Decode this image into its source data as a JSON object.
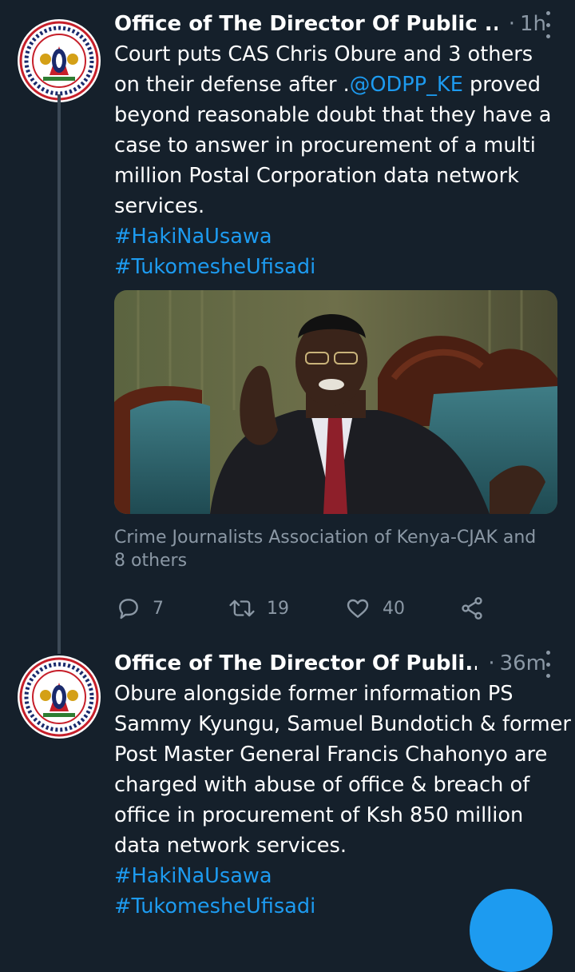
{
  "tweets": [
    {
      "author": "Office of The Director Of Public ...",
      "separator": "·",
      "time": "1h",
      "text_lines": [
        "Court puts CAS Chris Obure and 3 others",
        "on their defense after .",
        "beyond reasonable doubt that they have a",
        "case to answer in procurement of a multi",
        "million Postal Corporation data network",
        "services."
      ],
      "mention": "@ODPP_KE",
      "mention_after": " proved",
      "hashtags": [
        "#HakiNaUsawa",
        "#TukomesheUfisadi"
      ],
      "tagged": [
        "Crime Journalists Association of Kenya-CJAK and",
        "8 others"
      ],
      "actions": {
        "reply": {
          "icon": "reply-icon",
          "count": "7"
        },
        "retweet": {
          "icon": "retweet-icon",
          "count": "19"
        },
        "like": {
          "icon": "heart-icon",
          "count": "40"
        },
        "share": {
          "icon": "share-icon"
        }
      }
    },
    {
      "author": "Office of The Director Of Publi...",
      "separator": "·",
      "time": "36m",
      "text_lines": [
        "Obure alongside former information PS",
        "Sammy Kyungu, Samuel Bundotich & former",
        "Post Master General Francis Chahonyo are",
        "charged with abuse of office & breach of",
        "office in procurement of Ksh 850 million",
        "data network services."
      ],
      "hashtags": [
        "#HakiNaUsawa",
        "#TukomesheUfisadi"
      ]
    }
  ],
  "colors": {
    "background": "#15202b",
    "text": "#ffffff",
    "secondary": "#8b98a5",
    "link": "#1d9bf0"
  },
  "compose_button": {
    "icon": "compose-icon"
  }
}
